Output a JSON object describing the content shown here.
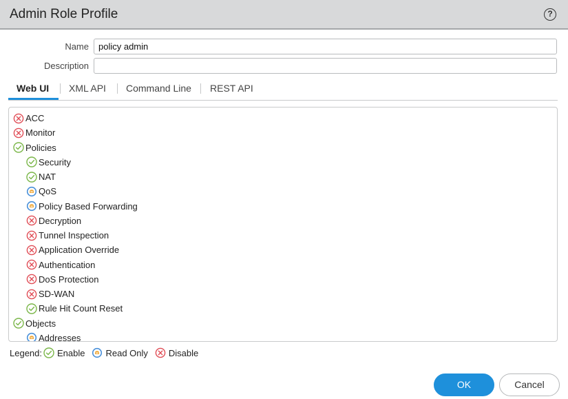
{
  "dialog": {
    "title": "Admin Role Profile",
    "help_icon": "help-circle-icon"
  },
  "form": {
    "name_label": "Name",
    "name_value": "policy admin",
    "description_label": "Description",
    "description_value": ""
  },
  "tabs": [
    {
      "label": "Web UI",
      "active": true
    },
    {
      "label": "XML API",
      "active": false
    },
    {
      "label": "Command Line",
      "active": false
    },
    {
      "label": "REST API",
      "active": false
    }
  ],
  "tree": [
    {
      "label": "ACC",
      "state": "disable",
      "level": 0
    },
    {
      "label": "Monitor",
      "state": "disable",
      "level": 0
    },
    {
      "label": "Policies",
      "state": "enable",
      "level": 0
    },
    {
      "label": "Security",
      "state": "enable",
      "level": 1
    },
    {
      "label": "NAT",
      "state": "enable",
      "level": 1
    },
    {
      "label": "QoS",
      "state": "readonly",
      "level": 1
    },
    {
      "label": "Policy Based Forwarding",
      "state": "readonly",
      "level": 1
    },
    {
      "label": "Decryption",
      "state": "disable",
      "level": 1
    },
    {
      "label": "Tunnel Inspection",
      "state": "disable",
      "level": 1
    },
    {
      "label": "Application Override",
      "state": "disable",
      "level": 1
    },
    {
      "label": "Authentication",
      "state": "disable",
      "level": 1
    },
    {
      "label": "DoS Protection",
      "state": "disable",
      "level": 1
    },
    {
      "label": "SD-WAN",
      "state": "disable",
      "level": 1
    },
    {
      "label": "Rule Hit Count Reset",
      "state": "enable",
      "level": 1
    },
    {
      "label": "Objects",
      "state": "enable",
      "level": 0
    },
    {
      "label": "Addresses",
      "state": "readonly",
      "level": 1
    }
  ],
  "legend": {
    "label": "Legend:",
    "items": [
      {
        "state": "enable",
        "label": "Enable"
      },
      {
        "state": "readonly",
        "label": "Read Only"
      },
      {
        "state": "disable",
        "label": "Disable"
      }
    ]
  },
  "buttons": {
    "ok": "OK",
    "cancel": "Cancel"
  },
  "colors": {
    "accent": "#1e90db",
    "enable": "#7ab648",
    "readonly_ring": "#4a90d9",
    "readonly_fill": "#f0a93b",
    "disable": "#e04b54"
  }
}
